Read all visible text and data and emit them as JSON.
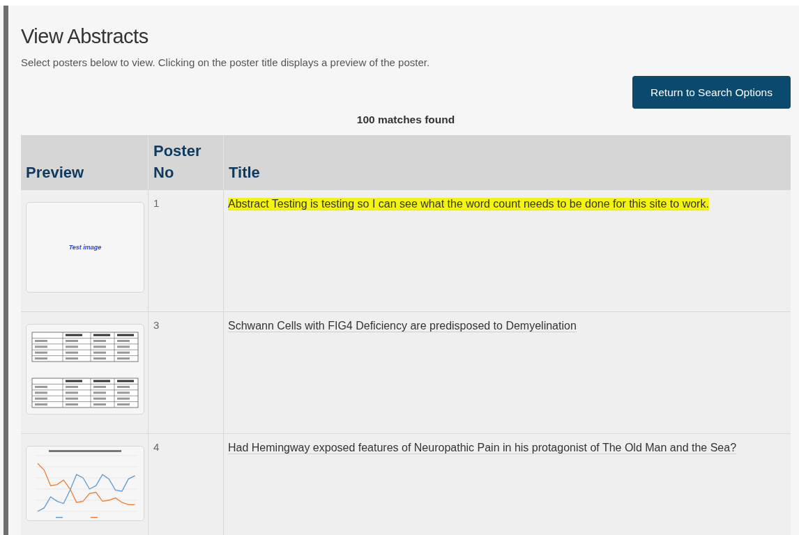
{
  "heading": "View Abstracts",
  "intro": "Select posters below to view. Clicking on the poster title displays a preview of the poster.",
  "return_button": "Return to Search Options",
  "match_count": "100 matches found",
  "table": {
    "columns": [
      {
        "label": "Preview"
      },
      {
        "label": "Poster No"
      },
      {
        "label": "Title"
      }
    ],
    "rows": [
      {
        "preview": {
          "kind": "text",
          "text": "Test image"
        },
        "number": "1",
        "title": "Abstract Testing is testing so I can see what the word count needs to be done for this site to work.",
        "highlighted": true
      },
      {
        "preview": {
          "kind": "table"
        },
        "number": "3",
        "title": "Schwann Cells with FIG4 Deficiency are predisposed to Demyelination",
        "highlighted": false
      },
      {
        "preview": {
          "kind": "chart"
        },
        "number": "4",
        "title": "Had Hemingway exposed features of Neuropathic Pain in his protagonist of The Old Man and the Sea?",
        "highlighted": false
      }
    ]
  }
}
